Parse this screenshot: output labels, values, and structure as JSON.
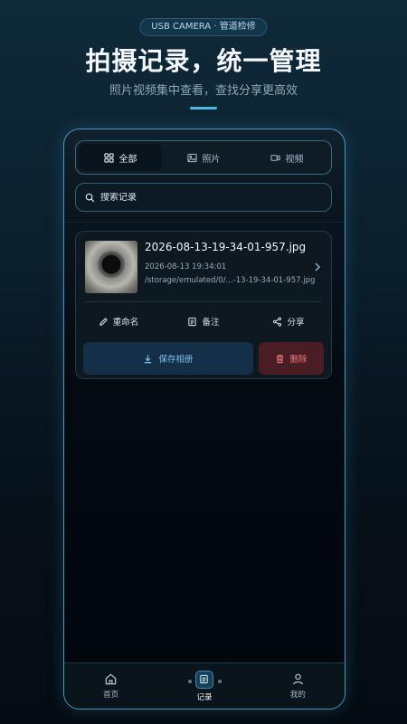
{
  "hero": {
    "badge": "USB CAMERA · 管道检修",
    "title": "拍摄记录，统一管理",
    "subtitle": "照片视频集中查看，查找分享更高效"
  },
  "tabs": [
    {
      "label": "全部",
      "icon": "grid-icon",
      "active": true
    },
    {
      "label": "照片",
      "icon": "image-icon",
      "active": false
    },
    {
      "label": "视频",
      "icon": "video-icon",
      "active": false
    }
  ],
  "search": {
    "placeholder": "搜索记录"
  },
  "record": {
    "filename": "2026-08-13-19-34-01-957.jpg",
    "datetime": "2026-08-13 19:34:01",
    "path": "/storage/emulated/0/...-13-19-34-01-957.jpg",
    "actions": {
      "rename": "重命名",
      "note": "备注",
      "share": "分享"
    },
    "save_label": "保存相册",
    "delete_label": "删除"
  },
  "nav": [
    {
      "label": "首页",
      "icon": "home-icon"
    },
    {
      "label": "记录",
      "icon": "records-icon",
      "active": true
    },
    {
      "label": "我的",
      "icon": "user-icon"
    }
  ],
  "colors": {
    "accent": "#4fb6e2",
    "danger": "#f07c7c",
    "save": "#7fc0ea"
  }
}
